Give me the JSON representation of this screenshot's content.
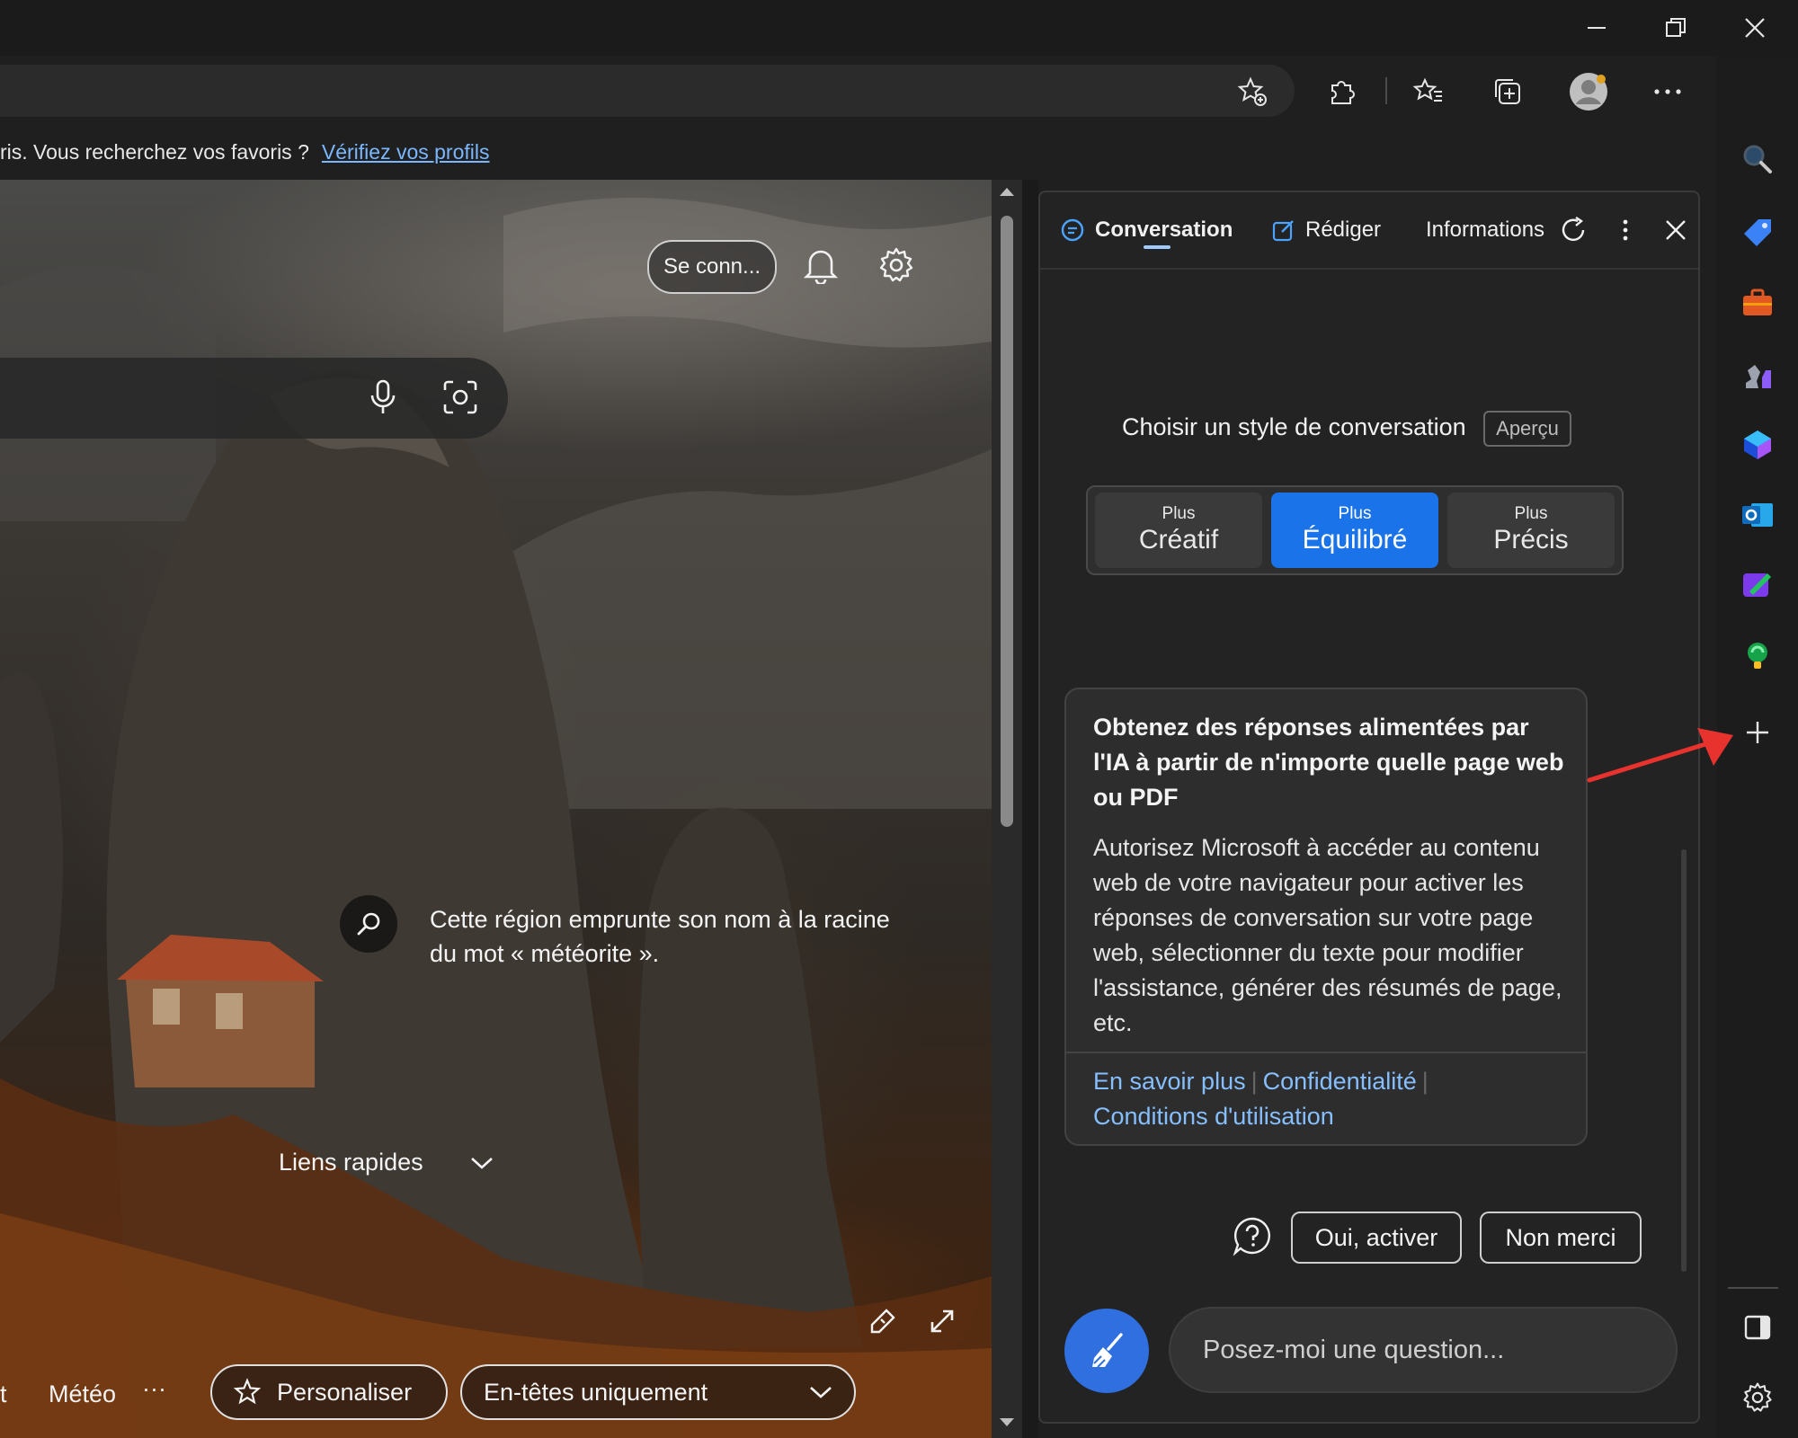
{
  "favorites_bar": {
    "message": "ris. Vous recherchez vos favoris ?",
    "link": "Vérifiez vos profils"
  },
  "page": {
    "signin_label": "Se conn...",
    "info_text": "Cette région emprunte son nom à la racine du mot « météorite ».",
    "quick_links": "Liens rapides",
    "bottom": {
      "fragment": "t",
      "weather": "Météo",
      "more": "···",
      "personalize": "Personaliser",
      "headlines": "En-têtes uniquement"
    }
  },
  "copilot": {
    "tabs": [
      "Conversation",
      "Rédiger",
      "Informations"
    ],
    "style_title": "Choisir un style de conversation",
    "preview_badge": "Aperçu",
    "styles": [
      {
        "top": "Plus",
        "bottom": "Créatif"
      },
      {
        "top": "Plus",
        "bottom": "Équilibré"
      },
      {
        "top": "Plus",
        "bottom": "Précis"
      }
    ],
    "selected_style": "Équilibré",
    "card": {
      "heading": "Obtenez des réponses alimentées par l'IA à partir de n'importe quelle page web ou PDF",
      "body": "Autorisez Microsoft à accéder au contenu web de votre navigateur pour activer les réponses de conversation sur votre page web, sélectionner du texte pour modifier l'assistance, générer des résumés de page, etc.",
      "links": [
        "En savoir plus",
        "Confidentialité",
        "Conditions d'utilisation"
      ]
    },
    "actions": {
      "accept": "Oui, activer",
      "decline": "Non merci"
    },
    "input_placeholder": "Posez-moi une question..."
  },
  "colors": {
    "accent": "#2f6fe0",
    "selected_style": "#1a73e8",
    "link": "#86bfff",
    "annotation_arrow": "#e8322e"
  },
  "icons": {
    "toolbar": [
      "add-favorite-icon",
      "extensions-icon",
      "favorites-icon",
      "collections-icon",
      "profile-icon",
      "more-icon",
      "bing-copilot-icon"
    ],
    "sidebar": [
      "search-icon",
      "shopping-tag-icon",
      "tools-icon",
      "games-icon",
      "microsoft365-icon",
      "outlook-icon",
      "designer-icon",
      "drop-icon",
      "add-icon",
      "sidebar-toggle-icon",
      "settings-icon"
    ]
  }
}
